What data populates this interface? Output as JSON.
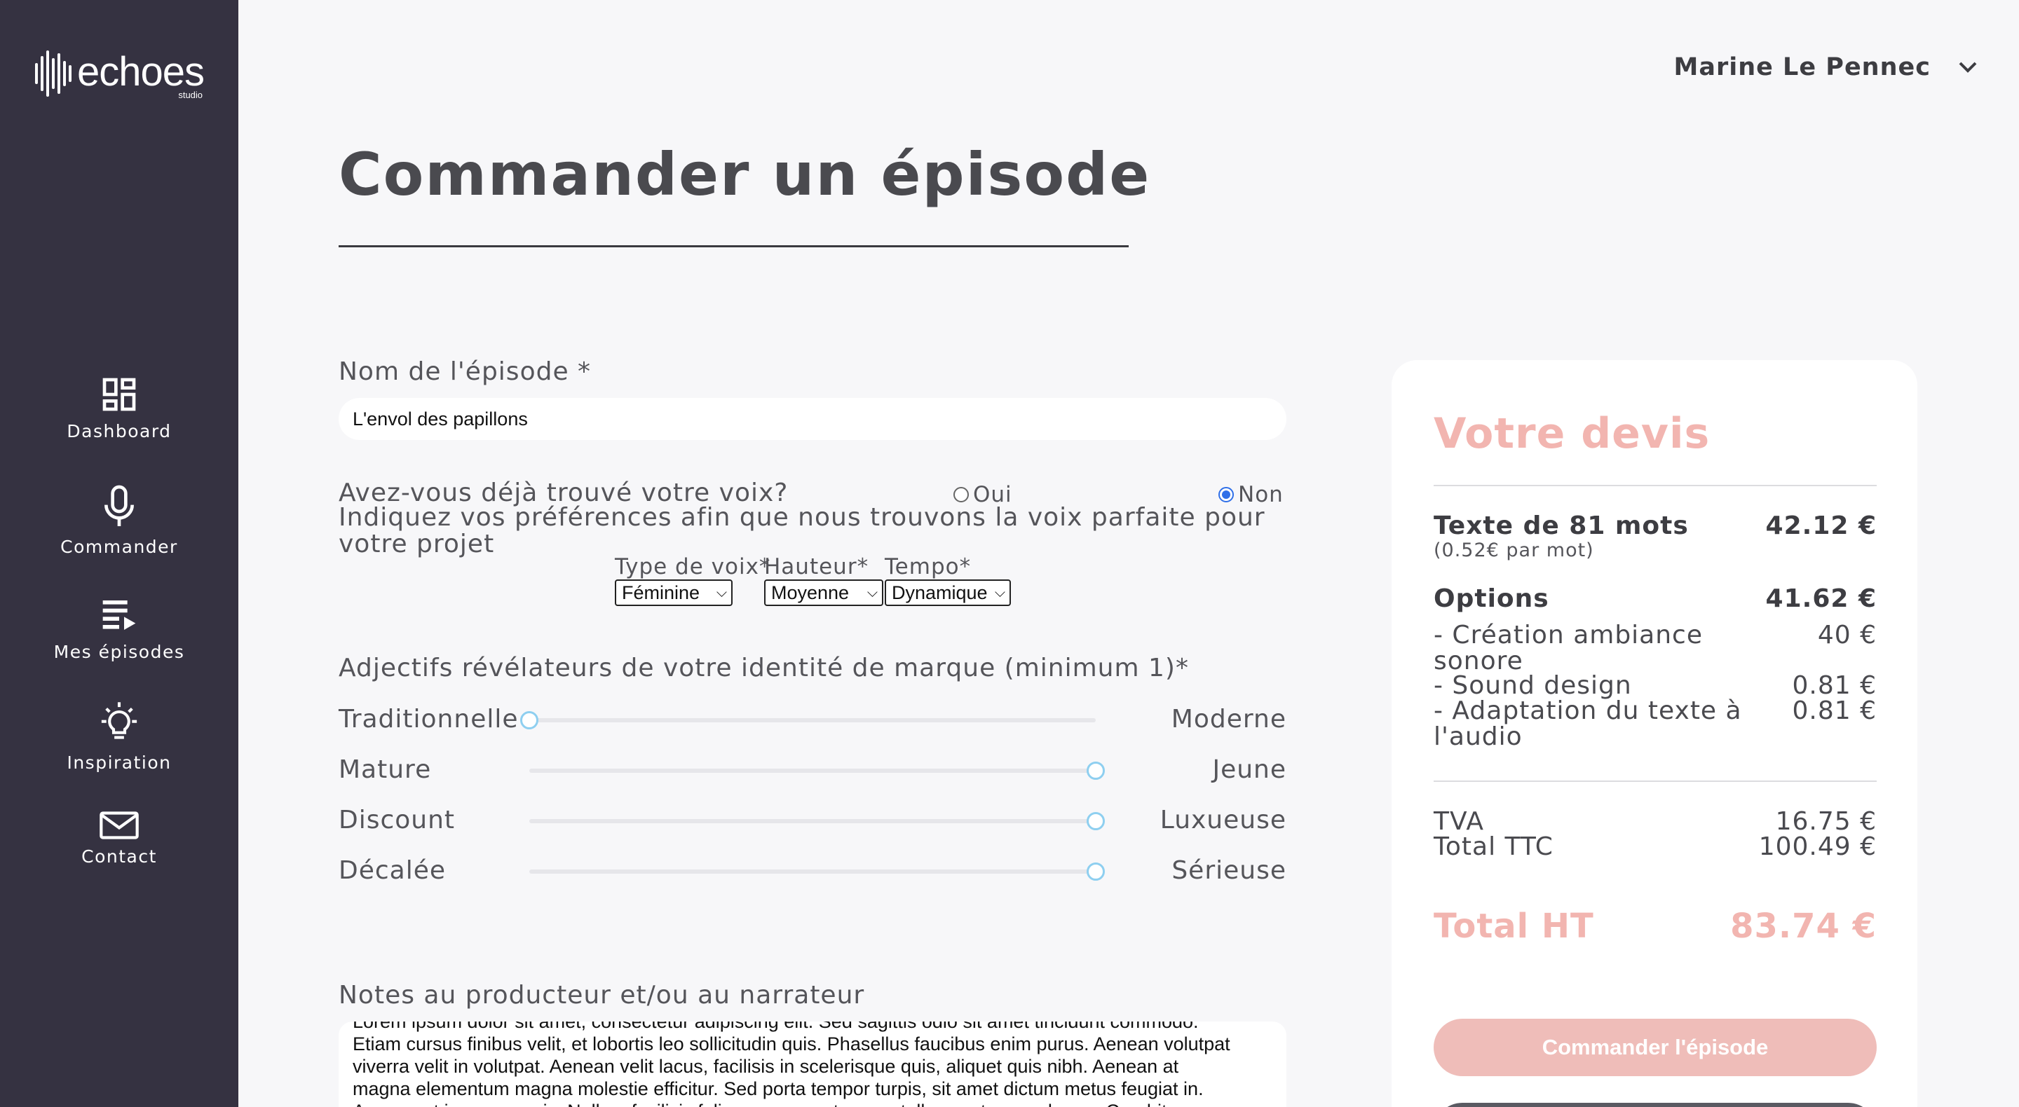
{
  "brand": {
    "name": "echoes",
    "sub": "studio"
  },
  "sidebar": {
    "items": [
      {
        "label": "Dashboard",
        "icon": "dashboard-icon"
      },
      {
        "label": "Commander",
        "icon": "microphone-icon"
      },
      {
        "label": "Mes épisodes",
        "icon": "playlist-icon"
      },
      {
        "label": "Inspiration",
        "icon": "lightbulb-icon"
      },
      {
        "label": "Contact",
        "icon": "mail-icon"
      }
    ]
  },
  "user": {
    "name": "Marine Le Pennec"
  },
  "page": {
    "title": "Commander un épisode"
  },
  "form": {
    "episode_name_label": "Nom de l'épisode *",
    "episode_name_value": "L'envol des papillons",
    "voice_question": "Avez-vous déjà trouvé votre voix?",
    "voice_options": {
      "yes": "Oui",
      "no": "Non",
      "selected": "Non"
    },
    "voice_help": "Indiquez vos préférences afin que nous trouvons la voix parfaite pour votre projet",
    "selects": {
      "type_label": "Type de voix*",
      "type_value": "Féminine",
      "pitch_label": "Hauteur*",
      "pitch_value": "Moyenne",
      "tempo_label": "Tempo*",
      "tempo_value": "Dynamique"
    },
    "adjectives_label": "Adjectifs révélateurs de votre identité de marque (minimum 1)*",
    "sliders": [
      {
        "left": "Traditionnelle",
        "right": "Moderne",
        "value": 0
      },
      {
        "left": "Mature",
        "right": "Jeune",
        "value": 1
      },
      {
        "left": "Discount",
        "right": "Luxueuse",
        "value": 1
      },
      {
        "left": "Décalée",
        "right": "Sérieuse",
        "value": 1
      }
    ],
    "notes_label": "Notes au producteur et/ou au narrateur",
    "notes_lines": [
      "Lorem ipsum dolor sit amet, consectetur adipiscing elit. Sed sagittis odio sit amet tincidunt commodo.",
      "Etiam cursus finibus velit, et lobortis leo sollicitudin quis. Phasellus faucibus enim purus. Aenean volutpat",
      "viverra velit in volutpat. Aenean velit lacus, facilisis in scelerisque quis, aliquet quis nibh. Aenean at",
      "magna elementum magna molestie efficitur. Sed porta tempor turpis, sit amet dictum metus feugiat in.",
      "Aenean et ipsum mauris. Nullam facilisis felis accumsan, tempus tellus ac, tempus lorem. Curabitur"
    ]
  },
  "quote": {
    "title": "Votre devis",
    "text_label": "Texte de 81 mots",
    "text_rate": "(0.52€ par mot)",
    "text_price": "42.12 €",
    "options_label": "Options",
    "options_price": "41.62 €",
    "option_items": [
      {
        "label": "- Création ambiance sonore",
        "price": "40 €"
      },
      {
        "label": "- Sound design",
        "price": "0.81 €"
      },
      {
        "label": "- Adaptation du texte à l'audio",
        "price": "0.81 €"
      }
    ],
    "tva_label": "TVA",
    "tva_value": "16.75 €",
    "ttc_label": "Total TTC",
    "ttc_value": "100.49 €",
    "total_ht_label": "Total HT",
    "total_ht_value": "83.74 €",
    "order_button": "Commander l'épisode"
  },
  "colors": {
    "sidebar": "#353241",
    "accent": "#f2b5b0",
    "slider_thumb": "#8ecff0",
    "radio_selected": "#2f6fe8"
  }
}
